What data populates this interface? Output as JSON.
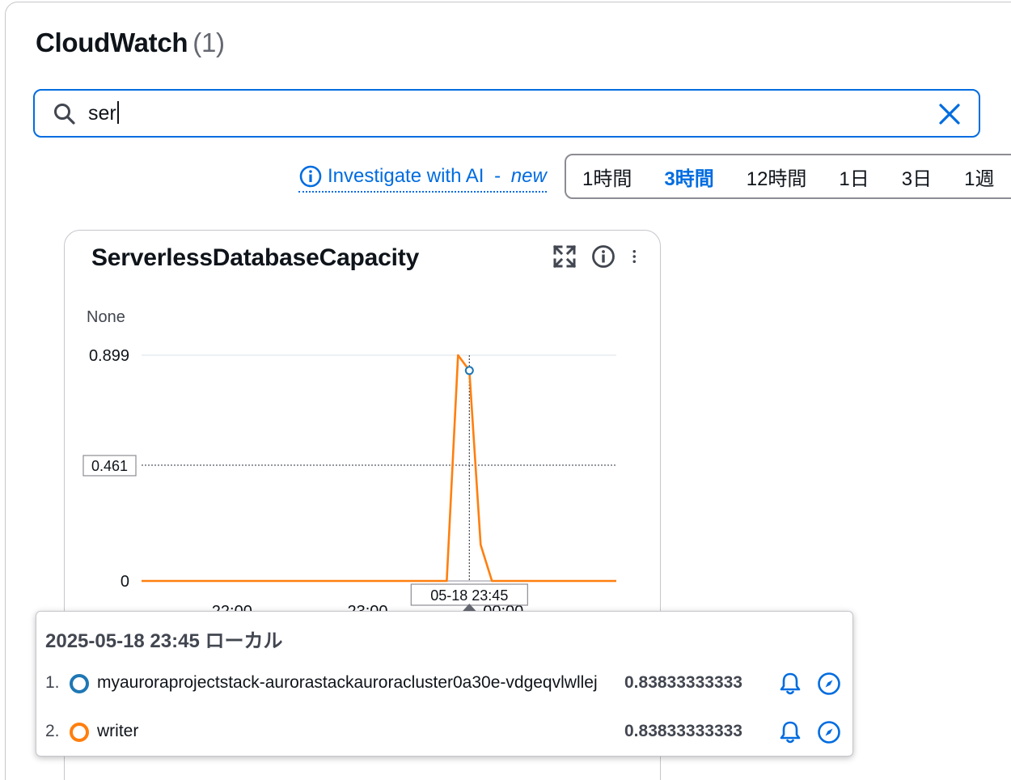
{
  "header": {
    "title": "CloudWatch",
    "count": "(1)"
  },
  "search": {
    "value": "ser",
    "icon": "search-icon",
    "clear_icon": "close-icon"
  },
  "investigate": {
    "label": "Investigate with AI",
    "separator": " - ",
    "new_tag": "new",
    "icon": "info-icon"
  },
  "time_range": {
    "options": [
      "1時間",
      "3時間",
      "12時間",
      "1日",
      "3日",
      "1週"
    ],
    "selected": "3時間"
  },
  "widget": {
    "title": "ServerlessDatabaseCapacity",
    "icons": [
      "expand-icon",
      "info-icon",
      "more-vertical-icon"
    ]
  },
  "chart_data": {
    "type": "line",
    "title": "ServerlessDatabaseCapacity",
    "ylabel": "None",
    "ylim": [
      0,
      0.899
    ],
    "yticks": [
      "0",
      "0.899"
    ],
    "xticks": [
      "22:00",
      "23:00",
      "00:00"
    ],
    "hover_y_label": "0.461",
    "hover_x_label": "05-18 23:45",
    "series": [
      {
        "color": "#ff7f0e",
        "x": [
          "21:20",
          "23:35",
          "23:40",
          "23:45",
          "23:50",
          "23:55",
          "00:50"
        ],
        "values": [
          0,
          0,
          0.899,
          0.838,
          0.144,
          0,
          0
        ]
      }
    ]
  },
  "tooltip": {
    "time": "2025-05-18 23:45 ローカル",
    "rows": [
      {
        "index": "1.",
        "name": "myauroraprojectstack-aurorastackauroracluster0a30e-vdgeqvlwllej",
        "value": "0.83833333333",
        "color": "#1f77b4"
      },
      {
        "index": "2.",
        "name": "writer",
        "value": "0.83833333333",
        "color": "#ff7f0e"
      }
    ]
  }
}
